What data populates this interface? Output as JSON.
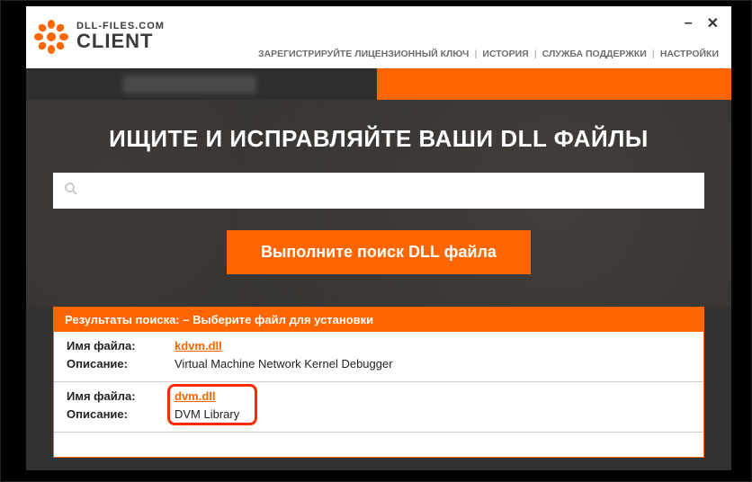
{
  "brand": {
    "top": "DLL-FILES.COM",
    "bottom": "CLIENT"
  },
  "menu": {
    "register": "ЗАРЕГИСТРИРУЙТЕ ЛИЦЕНЗИОННЫЙ КЛЮЧ",
    "history": "ИСТОРИЯ",
    "support": "СЛУЖБА ПОДДЕРЖКИ",
    "settings": "НАСТРОЙКИ"
  },
  "hero": {
    "title": "ИЩИТЕ И ИСПРАВЛЯЙТЕ ВАШИ DLL ФАЙЛЫ",
    "search_placeholder": "",
    "search_value": "",
    "button": "Выполните поиск DLL файла"
  },
  "results": {
    "header": "Результаты поиска:   – Выберите файл для установки",
    "label_filename": "Имя файла:",
    "label_description": "Описание:",
    "rows": [
      {
        "file": "kdvm.dll",
        "desc": "Virtual Machine Network Kernel Debugger"
      },
      {
        "file": "dvm.dll",
        "desc": "DVM Library"
      }
    ]
  }
}
